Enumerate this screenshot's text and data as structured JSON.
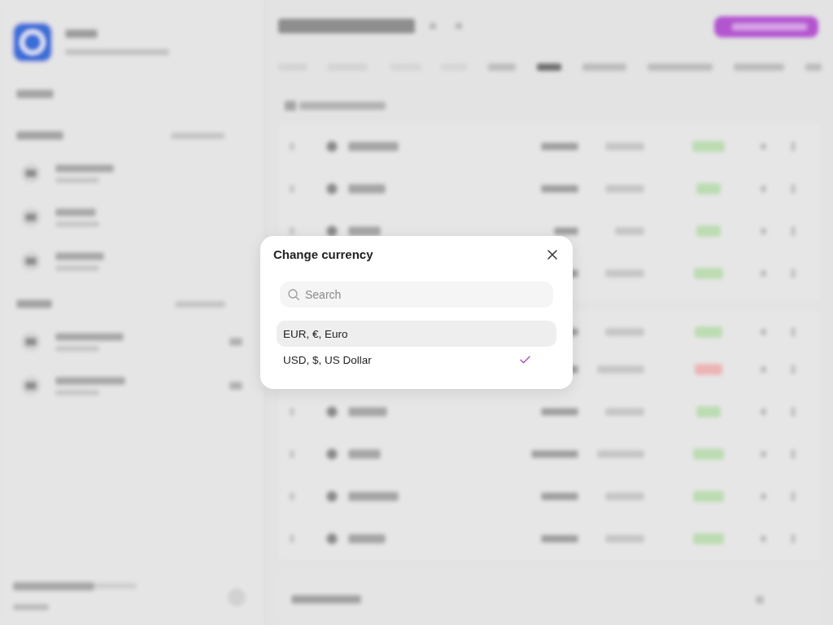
{
  "dialog": {
    "title": "Change currency",
    "search": {
      "placeholder": "Search"
    },
    "currencies": [
      {
        "label": "EUR, €, Euro",
        "selected": false,
        "highlighted": true
      },
      {
        "label": "USD, $, US Dollar",
        "selected": true,
        "highlighted": false
      }
    ]
  }
}
